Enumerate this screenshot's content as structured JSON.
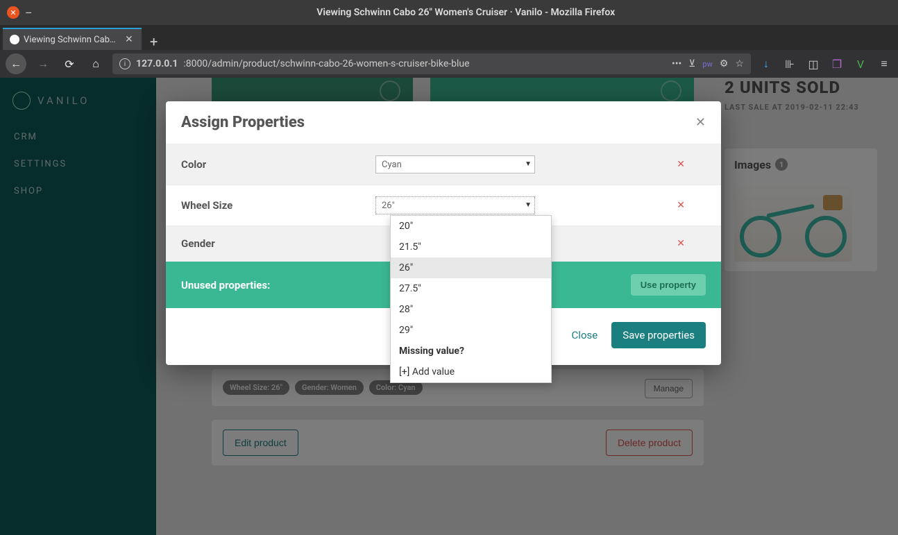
{
  "os": {
    "title": "Viewing Schwinn Cabo 26\" Women's Cruiser · Vanilo - Mozilla Firefox"
  },
  "browser": {
    "tab_title": "Viewing Schwinn Cabo 26",
    "url_host": "127.0.0.1",
    "url_path": ":8000/admin/product/schwinn-cabo-26-women-s-cruiser-bike-blue"
  },
  "sidebar": {
    "brand": "VANILO",
    "items": [
      {
        "label": "CRM"
      },
      {
        "label": "SETTINGS"
      },
      {
        "label": "SHOP"
      }
    ]
  },
  "right": {
    "units_sold": "2 UNITS SOLD",
    "last_sale": "LAST SALE AT 2019-02-11 22:43",
    "images_label": "Images",
    "images_count": "1"
  },
  "chips": [
    "Wheel Size: 26\"",
    "Gender: Women",
    "Color: Cyan"
  ],
  "buttons": {
    "manage": "Manage",
    "edit": "Edit product",
    "delete": "Delete product"
  },
  "modal": {
    "title": "Assign Properties",
    "rows": [
      {
        "label": "Color",
        "value": "Cyan"
      },
      {
        "label": "Wheel Size",
        "value": "26\""
      },
      {
        "label": "Gender",
        "value": ""
      }
    ],
    "unused_label": "Unused properties:",
    "use_property": "Use property",
    "close": "Close",
    "save": "Save properties"
  },
  "dropdown": {
    "options": [
      "20\"",
      "21.5\"",
      "26\"",
      "27.5\"",
      "28\"",
      "29\""
    ],
    "selected_index": 2,
    "missing_label": "Missing value?",
    "add_label": "[+] Add value"
  }
}
